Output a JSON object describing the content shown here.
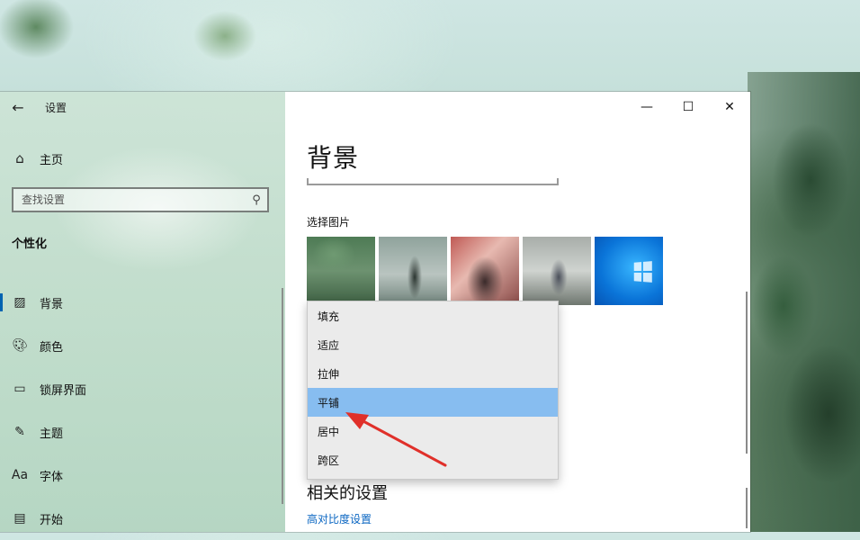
{
  "window": {
    "title": "设置"
  },
  "sidebar": {
    "home_label": "主页",
    "search_placeholder": "查找设置",
    "section_title": "个性化",
    "items": [
      {
        "label": "背景",
        "icon": "picture-icon",
        "selected": true
      },
      {
        "label": "颜色",
        "icon": "palette-icon",
        "selected": false
      },
      {
        "label": "锁屏界面",
        "icon": "lock-screen-icon",
        "selected": false
      },
      {
        "label": "主题",
        "icon": "theme-icon",
        "selected": false
      },
      {
        "label": "字体",
        "icon": "font-icon",
        "selected": false
      },
      {
        "label": "开始",
        "icon": "start-icon",
        "selected": false
      }
    ]
  },
  "content": {
    "page_title": "背景",
    "choose_picture_label": "选择图片",
    "related_title": "相关的设置",
    "contrast_link": "高对比度设置"
  },
  "dropdown": {
    "options": [
      "填充",
      "适应",
      "拉伸",
      "平铺",
      "居中",
      "跨区"
    ],
    "selected_index": 3
  },
  "colors": {
    "accent": "#0063b1",
    "dropdown_highlight": "#87bdf0",
    "link": "#0a66c2",
    "annotation_arrow": "#e0302a"
  }
}
